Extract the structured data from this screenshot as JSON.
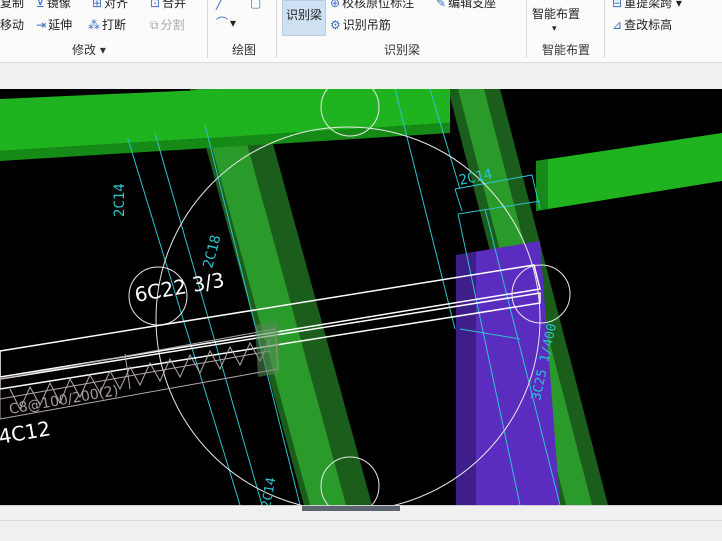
{
  "ribbon": {
    "modify_group": {
      "items": [
        "复制",
        "镜像",
        "对齐",
        "合并",
        "移动",
        "延伸",
        "打断",
        "分割"
      ],
      "label": "修改"
    },
    "draw_group": {
      "label": "绘图"
    },
    "identify_beam_group": {
      "active_button": "识别梁",
      "verify_label": "校核原位标注",
      "edit_support_label": "编辑支座",
      "hanger_label": "识别吊筋",
      "label": "识别梁"
    },
    "smart_layout_group": {
      "button": "智能布置",
      "label": "智能布置"
    },
    "right_group": {
      "span_label": "重提梁跨",
      "check_elev_label": "查改标高"
    }
  },
  "canvas": {
    "annotations": {
      "top_rebar": "6C22 3/3",
      "bottom_rebar": "4C12",
      "stirrup": "C8@100/200(2)",
      "col_label_1": "2C14",
      "col_label_2": "2C18",
      "col_label_3": "2C14",
      "col_label_4": "3C25 1/400",
      "col_label_5": "2C14"
    },
    "colors": {
      "background": "#000000",
      "beam_green": "#1fa81f",
      "column_green": "#1b6b1b",
      "purple": "#5a2cc0",
      "cyan_line": "#2ec4cf",
      "white_line": "#ffffff"
    }
  }
}
